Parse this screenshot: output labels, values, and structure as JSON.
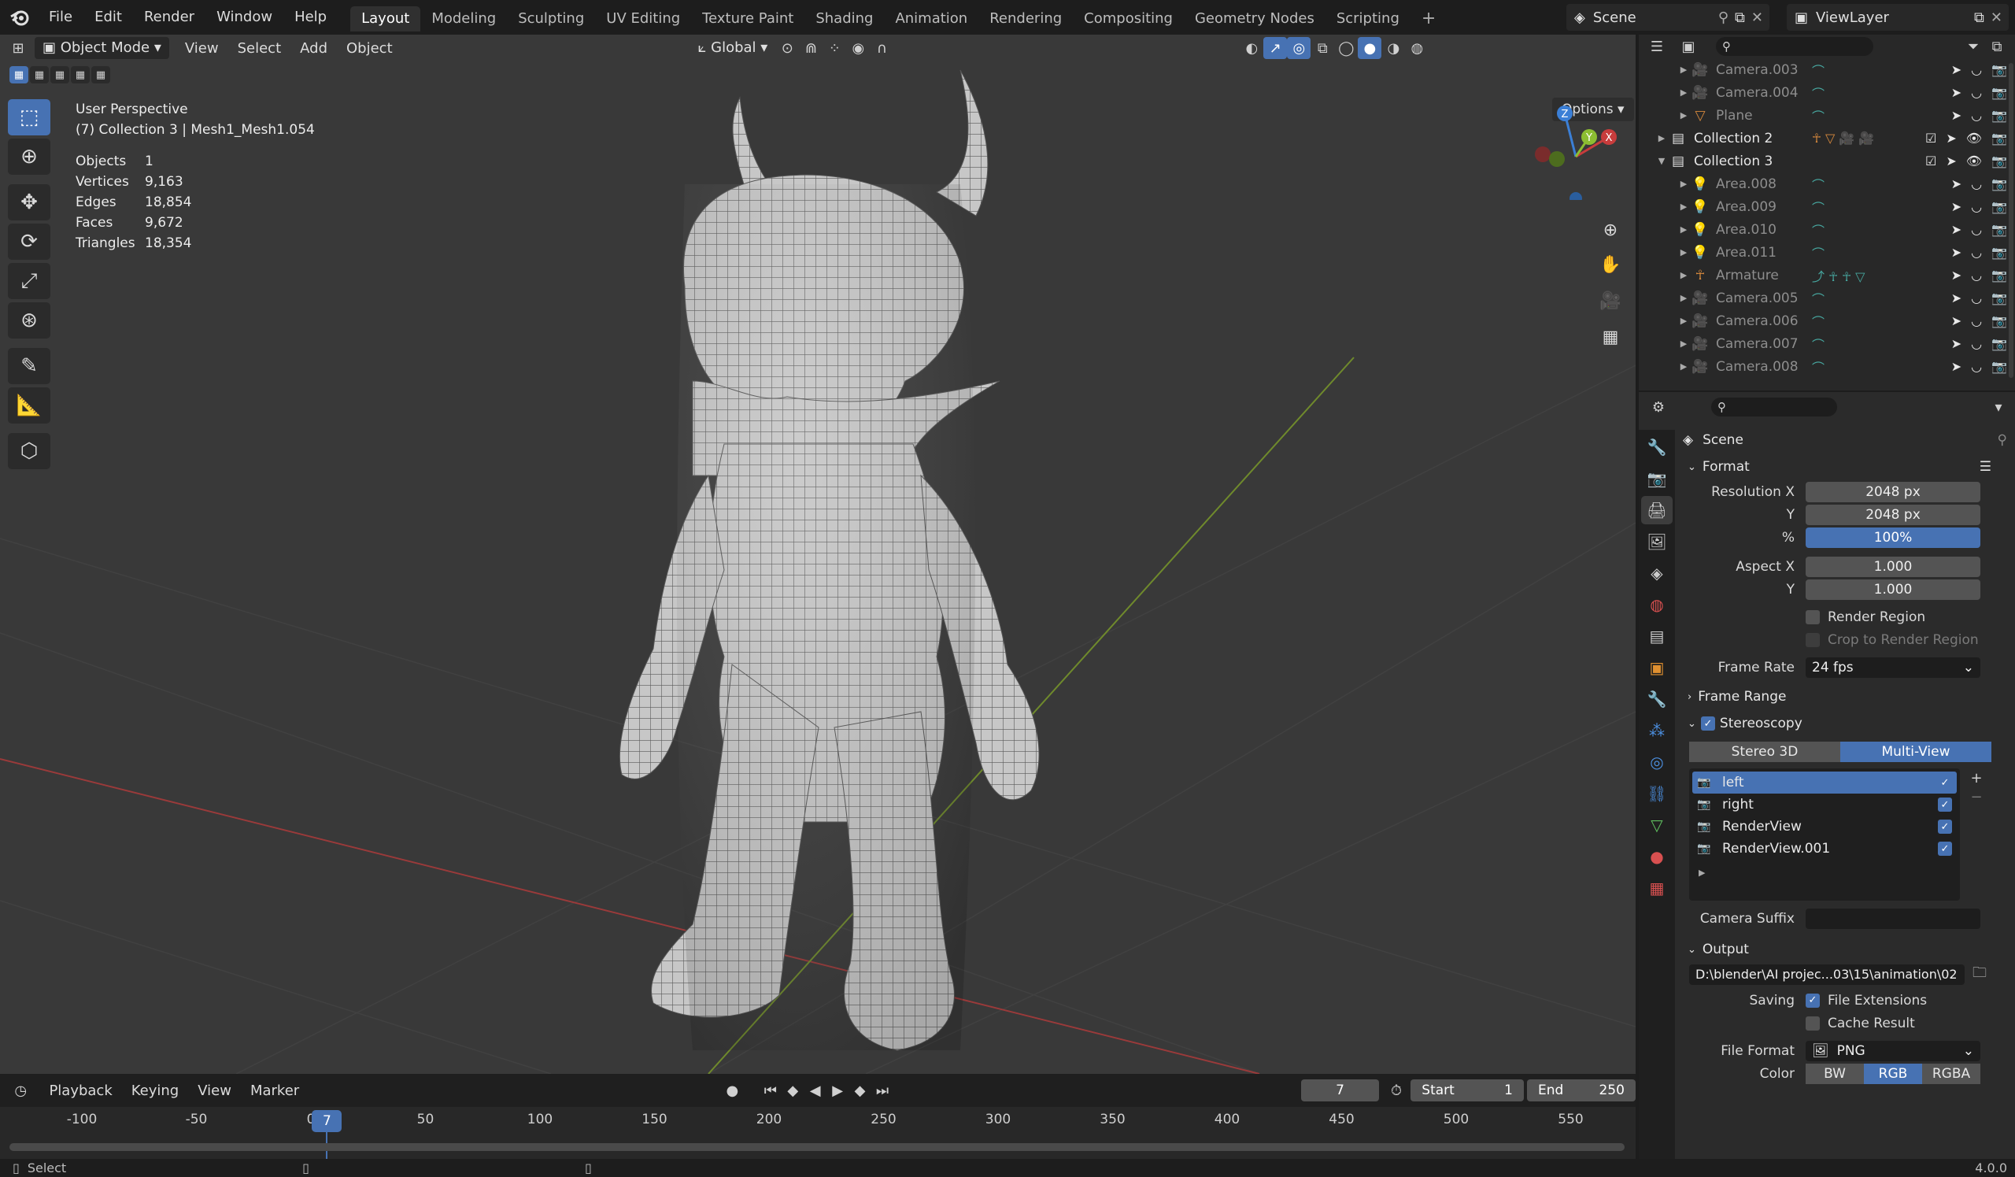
{
  "menu": {
    "items": [
      "File",
      "Edit",
      "Render",
      "Window",
      "Help"
    ],
    "workspaces": [
      "Layout",
      "Modeling",
      "Sculpting",
      "UV Editing",
      "Texture Paint",
      "Shading",
      "Animation",
      "Rendering",
      "Compositing",
      "Geometry Nodes",
      "Scripting"
    ],
    "active_workspace": "Layout",
    "add_tab": "+",
    "scene": "Scene",
    "view_layer": "ViewLayer"
  },
  "viewport": {
    "mode": "Object Mode",
    "menus": [
      "View",
      "Select",
      "Add",
      "Object"
    ],
    "transform_orientation": "Global",
    "options": "Options",
    "perspective": "User Perspective",
    "collection_path": "(7) Collection 3 | Mesh1_Mesh1.054",
    "stats": [
      {
        "key": "Objects",
        "value": "1"
      },
      {
        "key": "Vertices",
        "value": "9,163"
      },
      {
        "key": "Edges",
        "value": "18,854"
      },
      {
        "key": "Faces",
        "value": "9,672"
      },
      {
        "key": "Triangles",
        "value": "18,354"
      }
    ],
    "gizmo": {
      "x": "X",
      "y": "Y",
      "z": "Z"
    }
  },
  "timeline": {
    "menus": [
      "Playback",
      "Keying",
      "View",
      "Marker"
    ],
    "current_frame": "7",
    "start_label": "Start",
    "start": "1",
    "end_label": "End",
    "end": "250",
    "ruler": [
      "-100",
      "-50",
      "0",
      "50",
      "100",
      "150",
      "200",
      "250",
      "300",
      "350",
      "400",
      "450",
      "500",
      "550"
    ]
  },
  "statusbar": {
    "left": "Select",
    "version": "4.0.0"
  },
  "outliner": {
    "rows": [
      {
        "label": "Camera.003",
        "type": "camera",
        "indent": 2,
        "collection": false
      },
      {
        "label": "Camera.004",
        "type": "camera",
        "indent": 2,
        "collection": false
      },
      {
        "label": "Plane",
        "type": "mesh",
        "indent": 2,
        "collection": false
      },
      {
        "label": "Collection 2",
        "type": "collection",
        "indent": 1,
        "collection": true,
        "extra": "2 4"
      },
      {
        "label": "Collection 3",
        "type": "collection",
        "indent": 1,
        "collection": true,
        "expanded": true
      },
      {
        "label": "Area.008",
        "type": "light",
        "indent": 2,
        "collection": false
      },
      {
        "label": "Area.009",
        "type": "light",
        "indent": 2,
        "collection": false
      },
      {
        "label": "Area.010",
        "type": "light",
        "indent": 2,
        "collection": false
      },
      {
        "label": "Area.011",
        "type": "light",
        "indent": 2,
        "collection": false
      },
      {
        "label": "Armature",
        "type": "armature",
        "indent": 2,
        "collection": false
      },
      {
        "label": "Camera.005",
        "type": "camera",
        "indent": 2,
        "collection": false
      },
      {
        "label": "Camera.006",
        "type": "camera",
        "indent": 2,
        "collection": false
      },
      {
        "label": "Camera.007",
        "type": "camera",
        "indent": 2,
        "collection": false
      },
      {
        "label": "Camera.008",
        "type": "camera",
        "indent": 2,
        "collection": false
      }
    ]
  },
  "properties": {
    "context": "Scene",
    "format": {
      "title": "Format",
      "resolution_x_label": "Resolution X",
      "resolution_x": "2048 px",
      "y_label": "Y",
      "resolution_y": "2048 px",
      "percent_label": "%",
      "percent": "100%",
      "aspect_x_label": "Aspect X",
      "aspect_x": "1.000",
      "aspect_y_label": "Y",
      "aspect_y": "1.000",
      "render_region": "Render Region",
      "crop_region": "Crop to Render Region",
      "frame_rate_label": "Frame Rate",
      "frame_rate": "24 fps"
    },
    "frame_range": "Frame Range",
    "stereoscopy": {
      "title": "Stereoscopy",
      "modes": [
        "Stereo 3D",
        "Multi-View"
      ],
      "active_mode": "Multi-View",
      "views": [
        "left",
        "right",
        "RenderView",
        "RenderView.001"
      ],
      "camera_suffix_label": "Camera Suffix",
      "camera_suffix": ""
    },
    "output": {
      "title": "Output",
      "path": "D:\\blender\\AI projec...03\\15\\animation\\02",
      "saving_label": "Saving",
      "file_extensions": "File Extensions",
      "cache_result": "Cache Result",
      "file_format_label": "File Format",
      "file_format": "PNG",
      "color_label": "Color",
      "color_modes": [
        "BW",
        "RGB",
        "RGBA"
      ],
      "active_color": "RGB"
    }
  },
  "colors": {
    "accent": "#4772b3",
    "axis_x": "#c83c3c",
    "axis_y": "#8cbe32",
    "axis_z": "#3b7fd6",
    "background": "#393939"
  }
}
